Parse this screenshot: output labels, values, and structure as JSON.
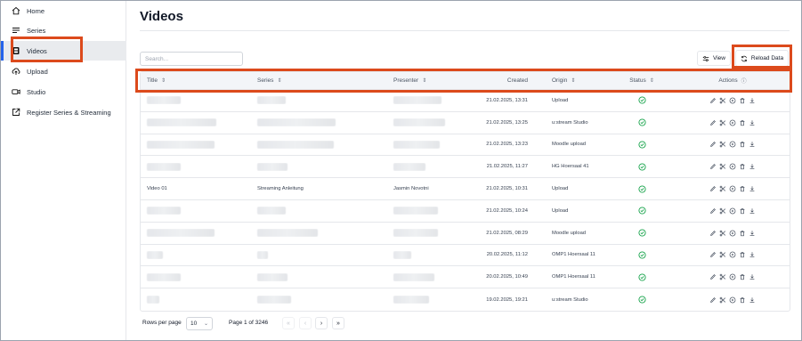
{
  "sidebar": {
    "items": [
      {
        "label": "Home",
        "icon": "home-icon"
      },
      {
        "label": "Series",
        "icon": "list-icon"
      },
      {
        "label": "Videos",
        "icon": "video-file-icon",
        "active": true
      },
      {
        "label": "Upload",
        "icon": "cloud-upload-icon"
      },
      {
        "label": "Studio",
        "icon": "camera-icon"
      },
      {
        "label": "Register Series & Streaming",
        "icon": "external-link-icon"
      }
    ]
  },
  "page": {
    "title": "Videos"
  },
  "toolbar": {
    "search_placeholder": "Search...",
    "view_label": "View",
    "reload_label": "Reload Data"
  },
  "table": {
    "columns": [
      "Title",
      "Series",
      "Presenter",
      "Created",
      "Origin",
      "Status",
      "Actions"
    ],
    "rows": [
      {
        "title": "",
        "series": "",
        "presenter": "",
        "created": "21.02.2025, 13:31",
        "origin": "Upload",
        "status": "ok"
      },
      {
        "title": "",
        "series": "",
        "presenter": "",
        "created": "21.02.2025, 13:25",
        "origin": "u:stream Studio",
        "status": "ok"
      },
      {
        "title": "",
        "series": "",
        "presenter": "",
        "created": "21.02.2025, 13:23",
        "origin": "Moodle upload",
        "status": "ok"
      },
      {
        "title": "",
        "series": "",
        "presenter": "",
        "created": "21.02.2025, 11:27",
        "origin": "HG Hoersaal 41",
        "status": "ok"
      },
      {
        "title": "Video 01",
        "series": "Streaming Anleitung",
        "presenter": "Jasmin Novotni",
        "created": "21.02.2025, 10:31",
        "origin": "Upload",
        "status": "ok"
      },
      {
        "title": "",
        "series": "",
        "presenter": "",
        "created": "21.02.2025, 10:24",
        "origin": "Upload",
        "status": "ok"
      },
      {
        "title": "",
        "series": "",
        "presenter": "",
        "created": "21.02.2025, 08:29",
        "origin": "Moodle upload",
        "status": "ok"
      },
      {
        "title": "",
        "series": "",
        "presenter": "",
        "created": "20.02.2025, 11:12",
        "origin": "OMP1 Hoersaal 11",
        "status": "ok"
      },
      {
        "title": "",
        "series": "",
        "presenter": "",
        "created": "20.02.2025, 10:49",
        "origin": "OMP1 Hoersaal 11",
        "status": "ok"
      },
      {
        "title": "",
        "series": "",
        "presenter": "",
        "created": "19.02.2025, 19:21",
        "origin": "u:stream Studio",
        "status": "ok"
      }
    ]
  },
  "footer": {
    "rows_per_page_label": "Rows per page",
    "rows_per_page_value": "10",
    "page_label": "Page 1 of 3246"
  },
  "colors": {
    "highlight": "#dc4a1c",
    "active_accent": "#2563eb",
    "status_ok": "#16a34a"
  }
}
